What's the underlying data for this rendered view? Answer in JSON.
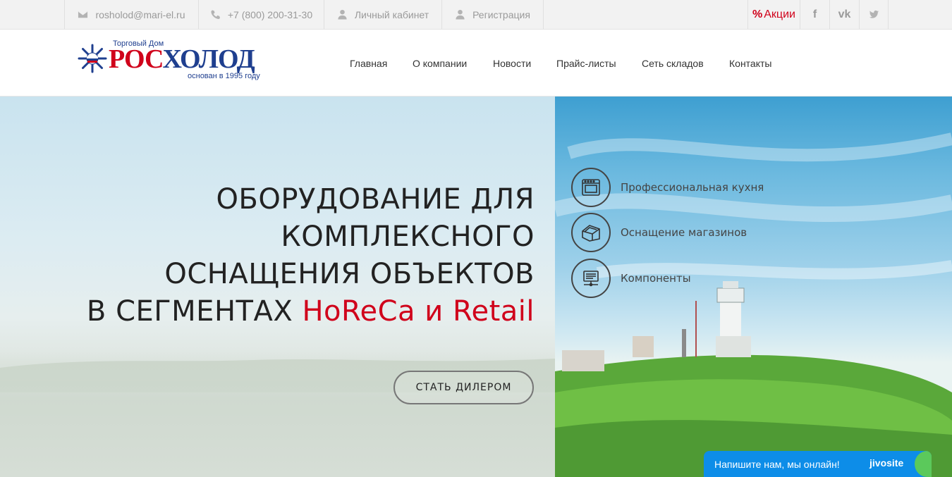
{
  "topbar": {
    "email": "rosholod@mari-el.ru",
    "phone": "+7 (800) 200-31-30",
    "cabinet": "Личный кабинет",
    "register": "Регистрация",
    "promo_symbol": "%",
    "promo": "Акции",
    "social": {
      "facebook": "f",
      "vk": "vk",
      "twitter": "t"
    },
    "icons": [
      "envelope-icon",
      "phone-icon",
      "user-icon",
      "user-icon",
      "percent-icon",
      "facebook-icon",
      "vk-icon",
      "twitter-icon"
    ]
  },
  "logo": {
    "small": "Торговый Дом",
    "ros": "РОС",
    "holod": "ХОЛОД",
    "founded": "основан в 1995 году"
  },
  "nav": [
    {
      "label": "Главная"
    },
    {
      "label": "О компании"
    },
    {
      "label": "Новости"
    },
    {
      "label": "Прайс-листы"
    },
    {
      "label": "Сеть складов"
    },
    {
      "label": "Контакты"
    }
  ],
  "hero": {
    "line1": "ОБОРУДОВАНИЕ ДЛЯ",
    "line2": "КОМПЛЕКСНОГО",
    "line3": "ОСНАЩЕНИЯ ОБЪЕКТОВ",
    "line4_plain": "В СЕГМЕНТАХ ",
    "line4_accent": "HoReCa и Retail",
    "button": "СТАТЬ ДИЛЕРОМ"
  },
  "categories": [
    {
      "label": "Профессиональная кухня",
      "icon": "oven-icon"
    },
    {
      "label": "Оснащение магазинов",
      "icon": "display-case-icon"
    },
    {
      "label": "Компоненты",
      "icon": "component-icon"
    }
  ],
  "chat": {
    "text": "Напишите нам, мы онлайн!",
    "brand": "jivosite"
  },
  "colors": {
    "accent_red": "#d0021b",
    "brand_blue": "#1f3f8f",
    "chat_blue": "#0d8de8",
    "chat_green": "#5bc95b"
  }
}
